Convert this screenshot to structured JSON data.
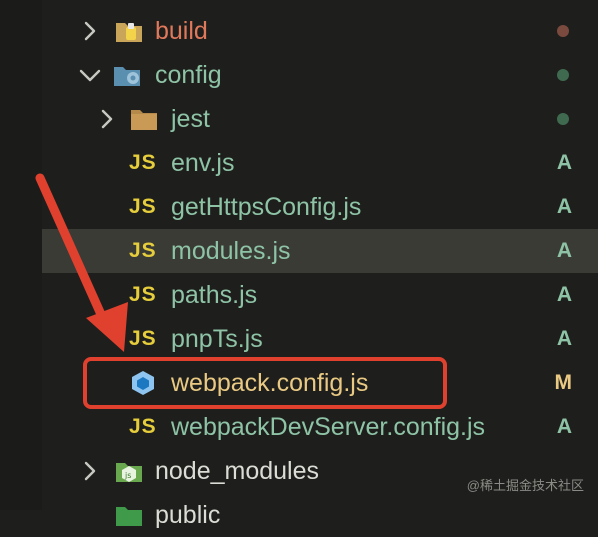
{
  "explorer": {
    "items": [
      {
        "label": "build",
        "icon": "build-folder-icon",
        "status": "",
        "status_color": "#7a4a3e",
        "color": "#e0785c"
      },
      {
        "label": "config",
        "icon": "config-folder-icon",
        "status": "",
        "status_color": "#3f6a4f",
        "color": "#8ec3a6"
      },
      {
        "label": "jest",
        "icon": "folder-icon",
        "status": "",
        "status_color": "#3f6a4f",
        "color": "#8ec3a6"
      },
      {
        "label": "env.js",
        "icon": "JS",
        "status": "A",
        "color": "#8ec3a6"
      },
      {
        "label": "getHttpsConfig.js",
        "icon": "JS",
        "status": "A",
        "color": "#8ec3a6"
      },
      {
        "label": "modules.js",
        "icon": "JS",
        "status": "A",
        "color": "#8ec3a6"
      },
      {
        "label": "paths.js",
        "icon": "JS",
        "status": "A",
        "color": "#8ec3a6"
      },
      {
        "label": "pnpTs.js",
        "icon": "JS",
        "status": "A",
        "color": "#8ec3a6"
      },
      {
        "label": "webpack.config.js",
        "icon": "webpack-icon",
        "status": "M",
        "color": "#e9c983"
      },
      {
        "label": "webpackDevServer.config.js",
        "icon": "JS",
        "status": "A",
        "color": "#8ec3a6"
      },
      {
        "label": "node_modules",
        "icon": "node-folder-icon",
        "status": "",
        "color": "#dcdcd6"
      },
      {
        "label": "public",
        "icon": "public-folder-icon",
        "status": "",
        "color": "#dcdcd6"
      }
    ],
    "selected_item": "modules.js",
    "highlighted_item": "webpack.config.js"
  },
  "watermark": "@稀土掘金技术社区",
  "colors": {
    "background": "#1e1f1c",
    "selection": "#3a3b35",
    "highlight_box": "#e0402e",
    "added": "#8ec3a6",
    "modified": "#e9c983",
    "js_icon": "#e6cd3c"
  }
}
